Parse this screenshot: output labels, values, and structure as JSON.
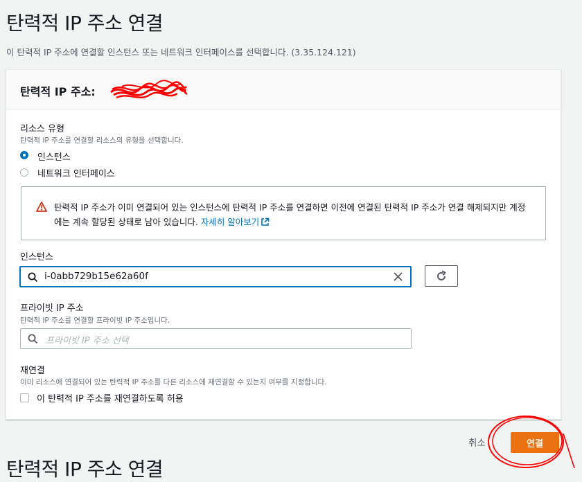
{
  "page": {
    "title": "탄력적 IP 주소 연결",
    "description": "이 탄력적 IP 주소에 연결할 인스턴스 또는 네트워크 인터페이스를 선택합니다. (3.35.124.121)"
  },
  "card": {
    "title": "탄력적 IP 주소:"
  },
  "resource_type": {
    "label": "리소스 유형",
    "description": "탄력적 IP 주소를 연결할 리소스의 유형을 선택합니다.",
    "options": [
      "인스턴스",
      "네트워크 인터페이스"
    ],
    "selected": "인스턴스"
  },
  "alert": {
    "text": "탄력적 IP 주소가 이미 연결되어 있는 인스턴스에 탄력적 IP 주소를 연결하면 이전에 연결된 탄력적 IP 주소가 연결 해제되지만 계정에는 계속 할당된 상태로 남아 있습니다.",
    "link": "자세히 알아보기",
    "icon": "warning-icon"
  },
  "instance": {
    "label": "인스턴스",
    "value": "i-0abb729b15e62a60f"
  },
  "private_ip": {
    "label": "프라이빗 IP 주소",
    "description": "탄력적 IP 주소를 연결할 프라이빗 IP 주소입니다.",
    "placeholder": "프라이빗 IP 주소 선택"
  },
  "reassociate": {
    "label": "재연결",
    "description": "이미 리소스에 연결되어 있는 탄력적 IP 주소를 다른 리소스에 재연결할 수 있는지 여부를 지정합니다.",
    "checkbox_label": "이 탄력적 IP 주소를 재연결하도록 허용",
    "checked": false
  },
  "actions": {
    "cancel": "취소",
    "connect": "연결"
  },
  "footer": {
    "title": "탄력적 IP 주소 연결"
  },
  "colors": {
    "primary": "#ec7211",
    "link": "#0073bb",
    "warning": "#d13212",
    "annotation": "#ff0000"
  }
}
